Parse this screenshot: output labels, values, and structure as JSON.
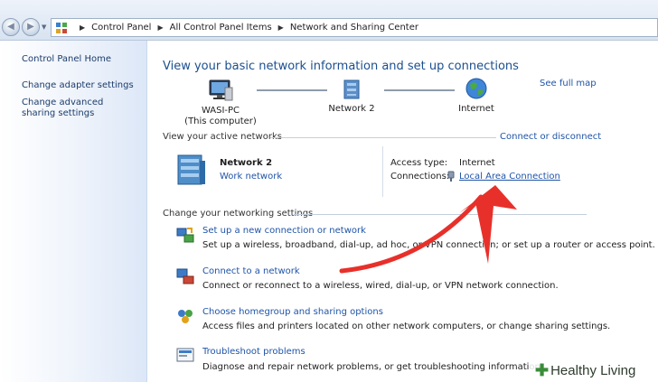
{
  "breadcrumb": {
    "items": [
      "Control Panel",
      "All Control Panel Items",
      "Network and Sharing Center"
    ]
  },
  "sidebar": {
    "items": [
      {
        "label": "Control Panel Home"
      },
      {
        "label": "Change adapter settings"
      },
      {
        "label": "Change advanced sharing settings"
      }
    ]
  },
  "main": {
    "title": "View your basic network information and set up connections",
    "see_full_map": "See full map",
    "map": {
      "computer_name": "WASI-PC",
      "computer_sub": "(This computer)",
      "network": "Network  2",
      "internet": "Internet"
    },
    "active": {
      "heading": "View your active networks",
      "connect_link": "Connect or disconnect",
      "network_name": "Network  2",
      "network_type": "Work network",
      "access_type_label": "Access type:",
      "access_type_value": "Internet",
      "connections_label": "Connections:",
      "connections_value": "Local Area Connection"
    },
    "change": {
      "heading": "Change your networking settings",
      "tasks": [
        {
          "link": "Set up a new connection or network",
          "desc": "Set up a wireless, broadband, dial-up, ad hoc, or VPN connection; or set up a router or access point."
        },
        {
          "link": "Connect to a network",
          "desc": "Connect or reconnect to a wireless, wired, dial-up, or VPN network connection."
        },
        {
          "link": "Choose homegroup and sharing options",
          "desc": "Access files and printers located on other network computers, or change sharing settings."
        },
        {
          "link": "Troubleshoot problems",
          "desc": "Diagnose and repair network problems, or get troubleshooting information."
        }
      ]
    }
  },
  "watermark": {
    "text": "Healthy Living"
  },
  "colors": {
    "link": "#1f54a8",
    "title": "#1b4f8f",
    "annotation_arrow": "#e8302a"
  }
}
